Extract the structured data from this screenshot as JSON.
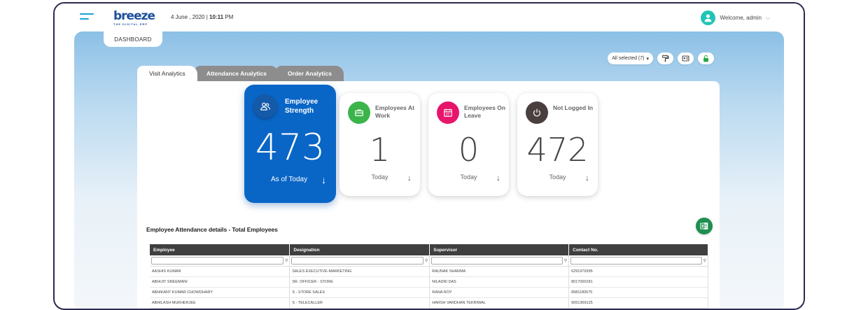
{
  "header": {
    "logo_text": "breeze",
    "logo_tagline": "THE DIGITAL ERP",
    "date": "4 June , 2020 |",
    "time": "10:11",
    "ampm": "PM",
    "welcome": "Welcome, admin"
  },
  "nav": {
    "dashboard_tab": "DASHBOARD"
  },
  "toolbar": {
    "selection": "All selected (7)"
  },
  "tabs": [
    {
      "label": "Visit Analytics",
      "active": true
    },
    {
      "label": "Attendance Analytics",
      "active": false
    },
    {
      "label": "Order Analytics",
      "active": false
    }
  ],
  "cards": [
    {
      "title": "Employee Strength",
      "value": "473",
      "footer": "As of Today",
      "color": "#0a66c6",
      "icon": "people-icon"
    },
    {
      "title": "Employees At Work",
      "value": "1",
      "footer": "Today",
      "color": "#3bb54a",
      "icon": "briefcase-icon"
    },
    {
      "title": "Employees On Leave",
      "value": "0",
      "footer": "Today",
      "color": "#e8156c",
      "icon": "calendar-icon"
    },
    {
      "title": "Not Logged In",
      "value": "472",
      "footer": "Today",
      "color": "#4a3f3f",
      "icon": "power-icon"
    }
  ],
  "section": {
    "title": "Employee Attendance details - Total Employees"
  },
  "table": {
    "columns": [
      "Employee",
      "Designation",
      "Supervisor",
      "Contact No."
    ],
    "rows": [
      [
        "AASHIS KUMAR",
        "SALES EXECUTIVE-MARKETING",
        "RAUNAK SHARMA",
        "6291979395"
      ],
      [
        "ABHIJIT SREEMANI",
        "SR. OFFICER - STORE",
        "NILADRI DAS",
        "8017000181"
      ],
      [
        "ABHIKANT KUMAR CHOWDHARY",
        "S - STORE SALES",
        "RANA ROY",
        "8981180675"
      ],
      [
        "ABHILASH MUKHERJEE",
        "S - TELECALLER",
        "HARSH VARDHAN TEKRIWAL",
        "9051369125"
      ]
    ]
  }
}
